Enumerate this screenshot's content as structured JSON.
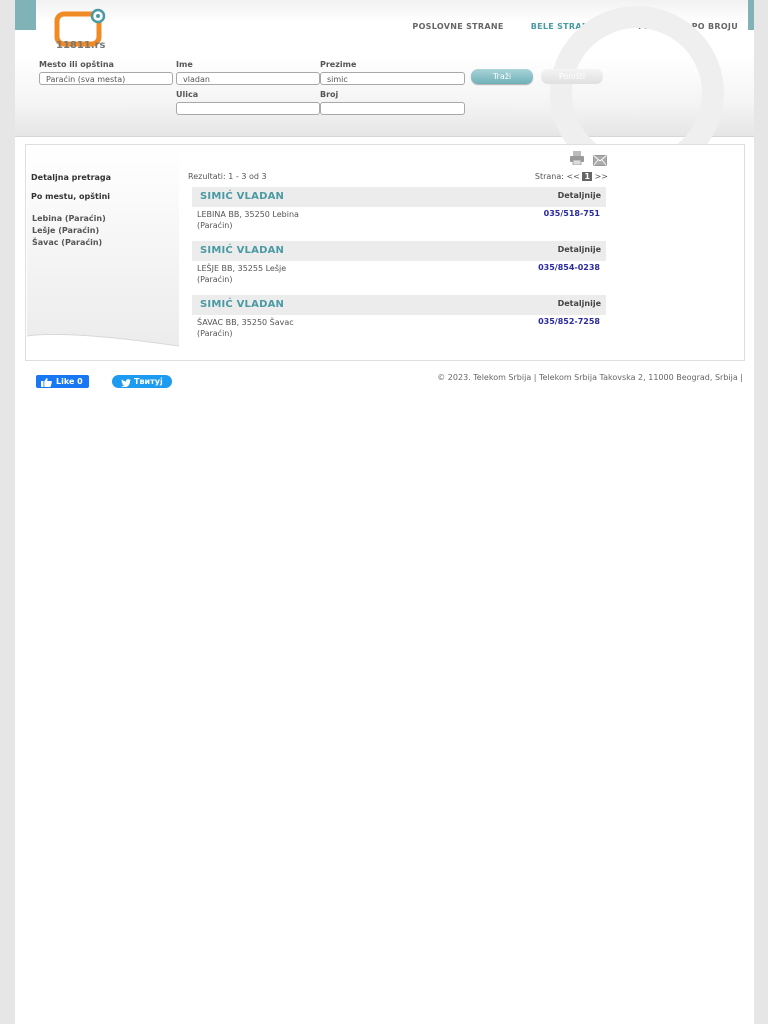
{
  "header": {
    "logo_text": "11811.rs",
    "nav": [
      "POSLOVNE STRANE",
      "BELE STRANE",
      "|",
      "PRETRAGA PO BROJU"
    ]
  },
  "search": {
    "place_label": "Mesto ili opština",
    "place_value": "Paraćin (sva mesta)",
    "name_label": "Ime",
    "name_value": "vladan",
    "surname_label": "Prezime",
    "surname_value": "simic",
    "street_label": "Ulica",
    "street_value": "",
    "number_label": "Broj",
    "number_value": "",
    "search_button": "Traži",
    "reset_button": "Poništi"
  },
  "sidebar": {
    "detailed_search": "Detaljna pretraga",
    "by_place": "Po mestu, opštini",
    "places": [
      "Lebina (Paraćin)",
      "Lešje (Paraćin)",
      "Šavac (Paraćin)"
    ]
  },
  "results": {
    "count_text": "Rezultati: 1 - 3 od 3",
    "pager_label": "Strana:",
    "pager_prev": "<<",
    "pager_current": "1",
    "pager_next": ">>",
    "items": [
      {
        "name": "SIMIĆ VLADAN",
        "details": "Detaljnije",
        "address_line1": "LEBINA BB, 35250 Lebina",
        "address_line2": "(Paraćin)",
        "phone": "035/518-751"
      },
      {
        "name": "SIMIĆ VLADAN",
        "details": "Detaljnije",
        "address_line1": "LEŠJE BB, 35255 Lešje",
        "address_line2": "(Paraćin)",
        "phone": "035/854-0238"
      },
      {
        "name": "SIMIĆ VLADAN",
        "details": "Detaljnije",
        "address_line1": "ŠAVAC BB, 35250 Šavac",
        "address_line2": "(Paraćin)",
        "phone": "035/852-7258"
      }
    ]
  },
  "footer": {
    "fb_like": "Like 0",
    "tweet": "Твитуј",
    "copyright": "© 2023. Telekom Srbija | Telekom Srbija Takovska 2, 11000 Beograd, Srbija |"
  },
  "colors": {
    "accent": "#4a9aa4",
    "phone": "#2a2aa0",
    "logo_orange": "#f08a24"
  },
  "icons": [
    "logo-icon",
    "print-icon",
    "mail-icon",
    "facebook-thumb-icon",
    "twitter-bird-icon"
  ]
}
